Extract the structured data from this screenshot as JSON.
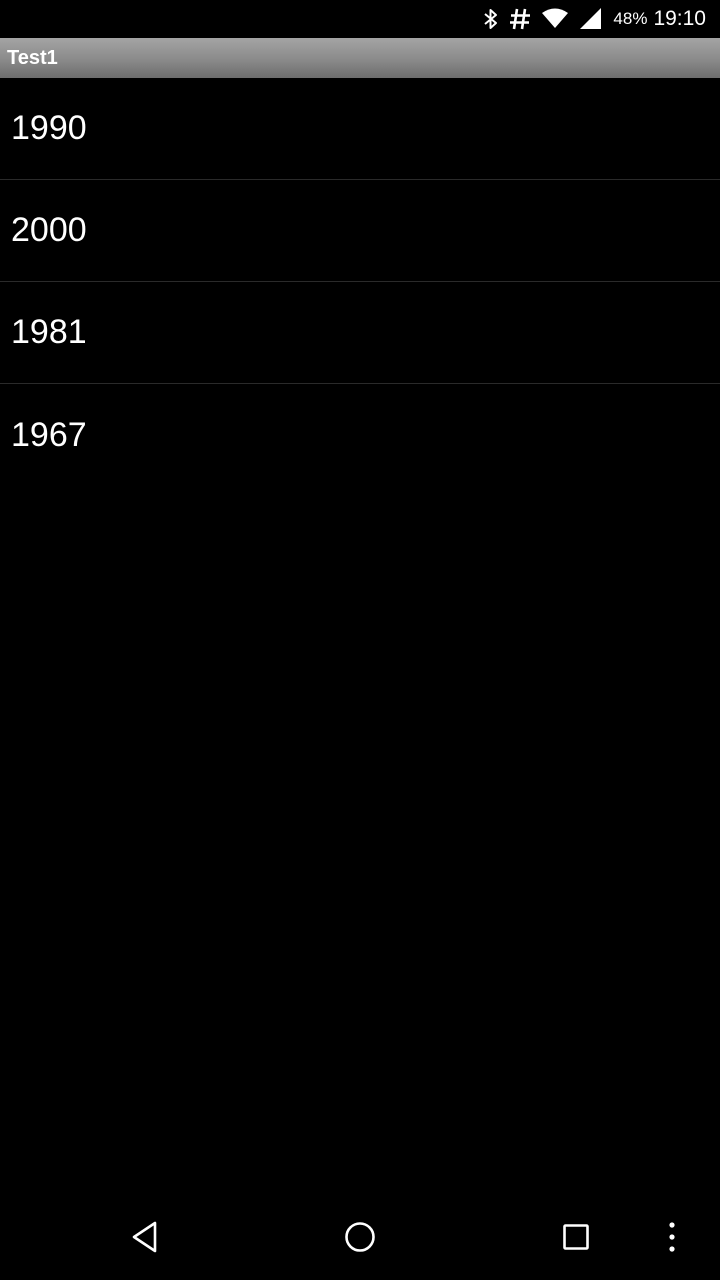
{
  "status_bar": {
    "icons": [
      "bluetooth-icon",
      "hash-icon",
      "wifi-icon",
      "cell-signal-icon"
    ],
    "battery": "48%",
    "time": "19:10"
  },
  "app": {
    "title": "Test1"
  },
  "list": {
    "items": [
      {
        "label": "1990"
      },
      {
        "label": "2000"
      },
      {
        "label": "1981"
      },
      {
        "label": "1967"
      }
    ]
  },
  "nav_bar": {
    "buttons": [
      "back-icon",
      "home-icon",
      "recents-icon",
      "overflow-menu-icon"
    ]
  },
  "colors": {
    "background": "#000000",
    "title_bar": "#8a8a8a",
    "text": "#ffffff",
    "divider": "#2a2a2a"
  }
}
